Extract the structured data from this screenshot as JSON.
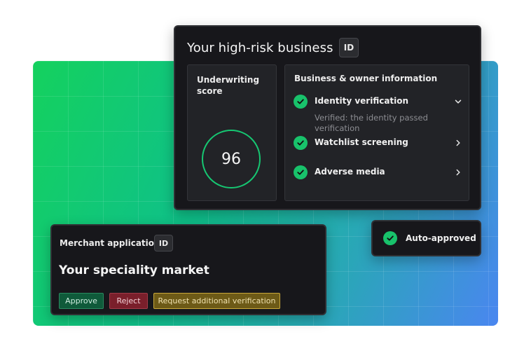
{
  "colors": {
    "accent_green": "#18c26b",
    "card_bg": "#17171b",
    "approve": "#0f5a3a",
    "reject": "#7a1f2b",
    "request": "#6d5a17"
  },
  "main_card": {
    "title": "Your high-risk business",
    "id_chip": "ID",
    "score": {
      "label": "Underwriting score",
      "value": "96"
    },
    "info": {
      "title": "Business & owner information",
      "items": [
        {
          "label": "Identity verification",
          "icon": "check-circle-icon",
          "chevron": "chevron-down-icon",
          "note": "Verified: the identity passed verification"
        },
        {
          "label": "Watchlist screening",
          "icon": "check-circle-icon",
          "chevron": "chevron-right-icon"
        },
        {
          "label": "Adverse media",
          "icon": "check-circle-icon",
          "chevron": "chevron-right-icon"
        }
      ]
    }
  },
  "auto_approved": {
    "label": "Auto-approved",
    "icon": "check-circle-icon"
  },
  "merchant_card": {
    "label": "Merchant application",
    "id_chip": "ID",
    "title": "Your speciality market",
    "buttons": {
      "approve": "Approve",
      "reject": "Reject",
      "request": "Request additional verification"
    }
  }
}
